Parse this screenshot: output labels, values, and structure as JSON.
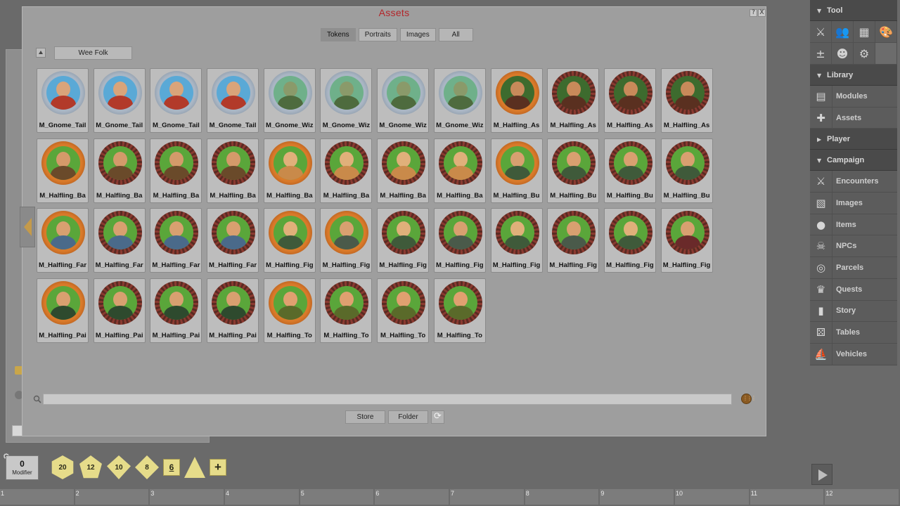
{
  "window": {
    "title": "Assets",
    "help_label": "?",
    "close_label": "X"
  },
  "tabs": [
    "Tokens",
    "Portraits",
    "Images",
    "All"
  ],
  "active_tab": "Tokens",
  "folder_label": "Wee Folk",
  "tokens": [
    {
      "label": "M_Gnome_Tail",
      "ring": "silver",
      "skin": "#d9a47a",
      "cloth": "#b23a2a",
      "bg": "#5aa9d6"
    },
    {
      "label": "M_Gnome_Tail",
      "ring": "silver",
      "skin": "#d9a47a",
      "cloth": "#b23a2a",
      "bg": "#5aa9d6"
    },
    {
      "label": "M_Gnome_Tail",
      "ring": "silver",
      "skin": "#d9a47a",
      "cloth": "#b23a2a",
      "bg": "#5aa9d6"
    },
    {
      "label": "M_Gnome_Tail",
      "ring": "silver",
      "skin": "#d9a47a",
      "cloth": "#b23a2a",
      "bg": "#5aa9d6"
    },
    {
      "label": "M_Gnome_Wiz",
      "ring": "silver",
      "skin": "#8a9a6a",
      "cloth": "#4e6b3e",
      "bg": "#6fb08a"
    },
    {
      "label": "M_Gnome_Wiz",
      "ring": "silver",
      "skin": "#8a9a6a",
      "cloth": "#4e6b3e",
      "bg": "#6fb08a"
    },
    {
      "label": "M_Gnome_Wiz",
      "ring": "silver",
      "skin": "#8a9a6a",
      "cloth": "#4e6b3e",
      "bg": "#6fb08a"
    },
    {
      "label": "M_Gnome_Wiz",
      "ring": "silver",
      "skin": "#8a9a6a",
      "cloth": "#4e6b3e",
      "bg": "#6fb08a"
    },
    {
      "label": "M_Halfling_As",
      "ring": "orange",
      "skin": "#c88a5a",
      "cloth": "#5a3020",
      "bg": "#3d6b2e"
    },
    {
      "label": "M_Halfling_As",
      "ring": "thorn",
      "skin": "#c88a5a",
      "cloth": "#5a3020",
      "bg": "#3d6b2e"
    },
    {
      "label": "M_Halfling_As",
      "ring": "thorn",
      "skin": "#c88a5a",
      "cloth": "#5a3020",
      "bg": "#3d6b2e"
    },
    {
      "label": "M_Halfling_As",
      "ring": "thorn",
      "skin": "#c88a5a",
      "cloth": "#5a3020",
      "bg": "#3d6b2e"
    },
    {
      "label": "M_Halfling_Ba",
      "ring": "orange",
      "skin": "#d49a6a",
      "cloth": "#6a4a2a",
      "bg": "#5aa63a"
    },
    {
      "label": "M_Halfling_Ba",
      "ring": "thorn",
      "skin": "#d49a6a",
      "cloth": "#6a4a2a",
      "bg": "#5aa63a"
    },
    {
      "label": "M_Halfling_Ba",
      "ring": "thorn",
      "skin": "#d49a6a",
      "cloth": "#6a4a2a",
      "bg": "#5aa63a"
    },
    {
      "label": "M_Halfling_Ba",
      "ring": "thorn",
      "skin": "#d49a6a",
      "cloth": "#6a4a2a",
      "bg": "#5aa63a"
    },
    {
      "label": "M_Halfling_Ba",
      "ring": "orange",
      "skin": "#e0b07a",
      "cloth": "#c98a4a",
      "bg": "#5aa63a"
    },
    {
      "label": "M_Halfling_Ba",
      "ring": "thorn",
      "skin": "#e0b07a",
      "cloth": "#c98a4a",
      "bg": "#5aa63a"
    },
    {
      "label": "M_Halfling_Ba",
      "ring": "thorn",
      "skin": "#e0b07a",
      "cloth": "#c98a4a",
      "bg": "#5aa63a"
    },
    {
      "label": "M_Halfling_Ba",
      "ring": "thorn",
      "skin": "#e0b07a",
      "cloth": "#c98a4a",
      "bg": "#5aa63a"
    },
    {
      "label": "M_Halfling_Bu",
      "ring": "orange",
      "skin": "#d8a070",
      "cloth": "#3f5a3a",
      "bg": "#5aa63a"
    },
    {
      "label": "M_Halfling_Bu",
      "ring": "thorn",
      "skin": "#d8a070",
      "cloth": "#3f5a3a",
      "bg": "#5aa63a"
    },
    {
      "label": "M_Halfling_Bu",
      "ring": "thorn",
      "skin": "#d8a070",
      "cloth": "#3f5a3a",
      "bg": "#5aa63a"
    },
    {
      "label": "M_Halfling_Bu",
      "ring": "thorn",
      "skin": "#d8a070",
      "cloth": "#3f5a3a",
      "bg": "#5aa63a"
    },
    {
      "label": "M_Halfling_Far",
      "ring": "orange",
      "skin": "#d8a070",
      "cloth": "#4a6a8a",
      "bg": "#5aa63a"
    },
    {
      "label": "M_Halfling_Far",
      "ring": "thorn",
      "skin": "#d8a070",
      "cloth": "#4a6a8a",
      "bg": "#5aa63a"
    },
    {
      "label": "M_Halfling_Far",
      "ring": "thorn",
      "skin": "#d8a070",
      "cloth": "#4a6a8a",
      "bg": "#5aa63a"
    },
    {
      "label": "M_Halfling_Far",
      "ring": "thorn",
      "skin": "#d8a070",
      "cloth": "#4a6a8a",
      "bg": "#5aa63a"
    },
    {
      "label": "M_Halfling_Fig",
      "ring": "orange",
      "skin": "#e0b07a",
      "cloth": "#3f5a3a",
      "bg": "#5aa63a"
    },
    {
      "label": "M_Halfling_Fig",
      "ring": "orange",
      "skin": "#d8a070",
      "cloth": "#4a5a4a",
      "bg": "#5aa63a"
    },
    {
      "label": "M_Halfling_Fig",
      "ring": "thorn",
      "skin": "#e0b07a",
      "cloth": "#3f5a3a",
      "bg": "#5aa63a"
    },
    {
      "label": "M_Halfling_Fig",
      "ring": "thorn",
      "skin": "#d8a070",
      "cloth": "#4a5a4a",
      "bg": "#5aa63a"
    },
    {
      "label": "M_Halfling_Fig",
      "ring": "thorn",
      "skin": "#e0b07a",
      "cloth": "#3f5a3a",
      "bg": "#5aa63a"
    },
    {
      "label": "M_Halfling_Fig",
      "ring": "thorn",
      "skin": "#d8a070",
      "cloth": "#4a5a4a",
      "bg": "#5aa63a"
    },
    {
      "label": "M_Halfling_Fig",
      "ring": "thorn",
      "skin": "#e0b07a",
      "cloth": "#3f5a3a",
      "bg": "#5aa63a"
    },
    {
      "label": "M_Halfling_Fig",
      "ring": "thorn",
      "skin": "#d8a070",
      "cloth": "#6a2a2a",
      "bg": "#5aa63a"
    },
    {
      "label": "M_Halfling_Pai",
      "ring": "orange",
      "skin": "#d8a070",
      "cloth": "#2e4a2e",
      "bg": "#5aa63a"
    },
    {
      "label": "M_Halfling_Pai",
      "ring": "thorn",
      "skin": "#d8a070",
      "cloth": "#2e4a2e",
      "bg": "#5aa63a"
    },
    {
      "label": "M_Halfling_Pai",
      "ring": "thorn",
      "skin": "#d8a070",
      "cloth": "#2e4a2e",
      "bg": "#5aa63a"
    },
    {
      "label": "M_Halfling_Pai",
      "ring": "thorn",
      "skin": "#d8a070",
      "cloth": "#2e4a2e",
      "bg": "#5aa63a"
    },
    {
      "label": "M_Halfling_To",
      "ring": "orange",
      "skin": "#e0a070",
      "cloth": "#5a6a2a",
      "bg": "#5aa63a"
    },
    {
      "label": "M_Halfling_To",
      "ring": "thorn",
      "skin": "#e0a070",
      "cloth": "#5a6a2a",
      "bg": "#5aa63a"
    },
    {
      "label": "M_Halfling_To",
      "ring": "thorn",
      "skin": "#e0a070",
      "cloth": "#5a6a2a",
      "bg": "#5aa63a"
    },
    {
      "label": "M_Halfling_To",
      "ring": "thorn",
      "skin": "#e0a070",
      "cloth": "#5a6a2a",
      "bg": "#5aa63a"
    }
  ],
  "search": {
    "value": ""
  },
  "buttons": {
    "store": "Store",
    "folder": "Folder",
    "refresh_icon": "refresh-icon"
  },
  "sidebar": {
    "tool": {
      "label": "Tool",
      "icons": [
        "crossed-swords-icon",
        "party-icon",
        "calendar-icon",
        "palette-icon",
        "modifier-icon",
        "effects-icon",
        "options-gear-icon"
      ]
    },
    "library": {
      "label": "Library",
      "items": [
        {
          "label": "Modules",
          "icon": "books-icon"
        },
        {
          "label": "Assets",
          "icon": "puzzle-icon"
        }
      ]
    },
    "player": {
      "label": "Player"
    },
    "campaign": {
      "label": "Campaign",
      "items": [
        {
          "label": "Encounters",
          "icon": "crossed-swords-icon"
        },
        {
          "label": "Images",
          "icon": "map-icon"
        },
        {
          "label": "Items",
          "icon": "bag-icon"
        },
        {
          "label": "NPCs",
          "icon": "skull-icon"
        },
        {
          "label": "Parcels",
          "icon": "coins-icon"
        },
        {
          "label": "Quests",
          "icon": "trophy-icon"
        },
        {
          "label": "Story",
          "icon": "book-icon"
        },
        {
          "label": "Tables",
          "icon": "dice-icon"
        },
        {
          "label": "Vehicles",
          "icon": "ship-icon"
        }
      ]
    }
  },
  "modifier": {
    "value": "0",
    "label": "Modifier"
  },
  "dice": [
    "20",
    "12",
    "10",
    "8",
    "6",
    "",
    "+"
  ],
  "hotkeys": [
    "1",
    "2",
    "3",
    "4",
    "5",
    "6",
    "7",
    "8",
    "9",
    "10",
    "11",
    "12"
  ],
  "colors": {
    "title": "#b3262a",
    "ring_orange": "#c4621c",
    "ring_silver": "#aab6c4",
    "ring_thorn": "#5a2a22",
    "die": "#e6dc8a"
  }
}
